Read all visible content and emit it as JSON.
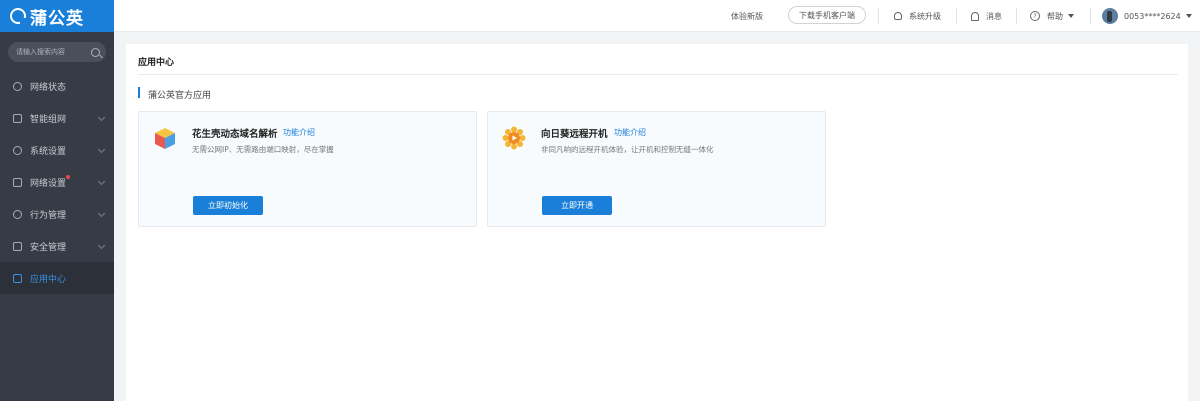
{
  "brand": {
    "name": "蒲公英"
  },
  "sidebar": {
    "search_placeholder": "请输入搜索内容",
    "items": [
      {
        "label": "网络状态",
        "icon": "network-status-icon",
        "has_chevron": false,
        "active": false
      },
      {
        "label": "智能组网",
        "icon": "smart-network-icon",
        "has_chevron": true,
        "active": false
      },
      {
        "label": "系统设置",
        "icon": "gear-icon",
        "has_chevron": true,
        "active": false
      },
      {
        "label": "网络设置",
        "icon": "network-settings-icon",
        "has_chevron": true,
        "active": false,
        "badge_dot": true
      },
      {
        "label": "行为管理",
        "icon": "behavior-icon",
        "has_chevron": true,
        "active": false
      },
      {
        "label": "安全管理",
        "icon": "shield-icon",
        "has_chevron": true,
        "active": false
      },
      {
        "label": "应用中心",
        "icon": "app-center-icon",
        "has_chevron": false,
        "active": true
      }
    ]
  },
  "topbar": {
    "new_version": "体验新版",
    "download_client": "下载手机客户端",
    "system_upgrade": "系统升级",
    "messages": "消息",
    "help": "帮助",
    "user": "0053****2624"
  },
  "main": {
    "title": "应用中心",
    "section_title": "蒲公英官方应用",
    "apps": [
      {
        "name": "花生壳动态域名解析",
        "link": "功能介绍",
        "desc": "无需公网IP、无需路由端口映射，尽在掌握",
        "button": "立即初始化",
        "icon": "peanut-shell-cube-icon"
      },
      {
        "name": "向日葵远程开机",
        "link": "功能介绍",
        "desc": "非同凡响的远程开机体验，让开机和控制无缝一体化",
        "button": "立即开通",
        "icon": "sunflower-icon"
      }
    ]
  },
  "colors": {
    "accent": "#1a7fd8",
    "sidebar_bg": "#363b45",
    "active_text": "#3d8fe6"
  }
}
